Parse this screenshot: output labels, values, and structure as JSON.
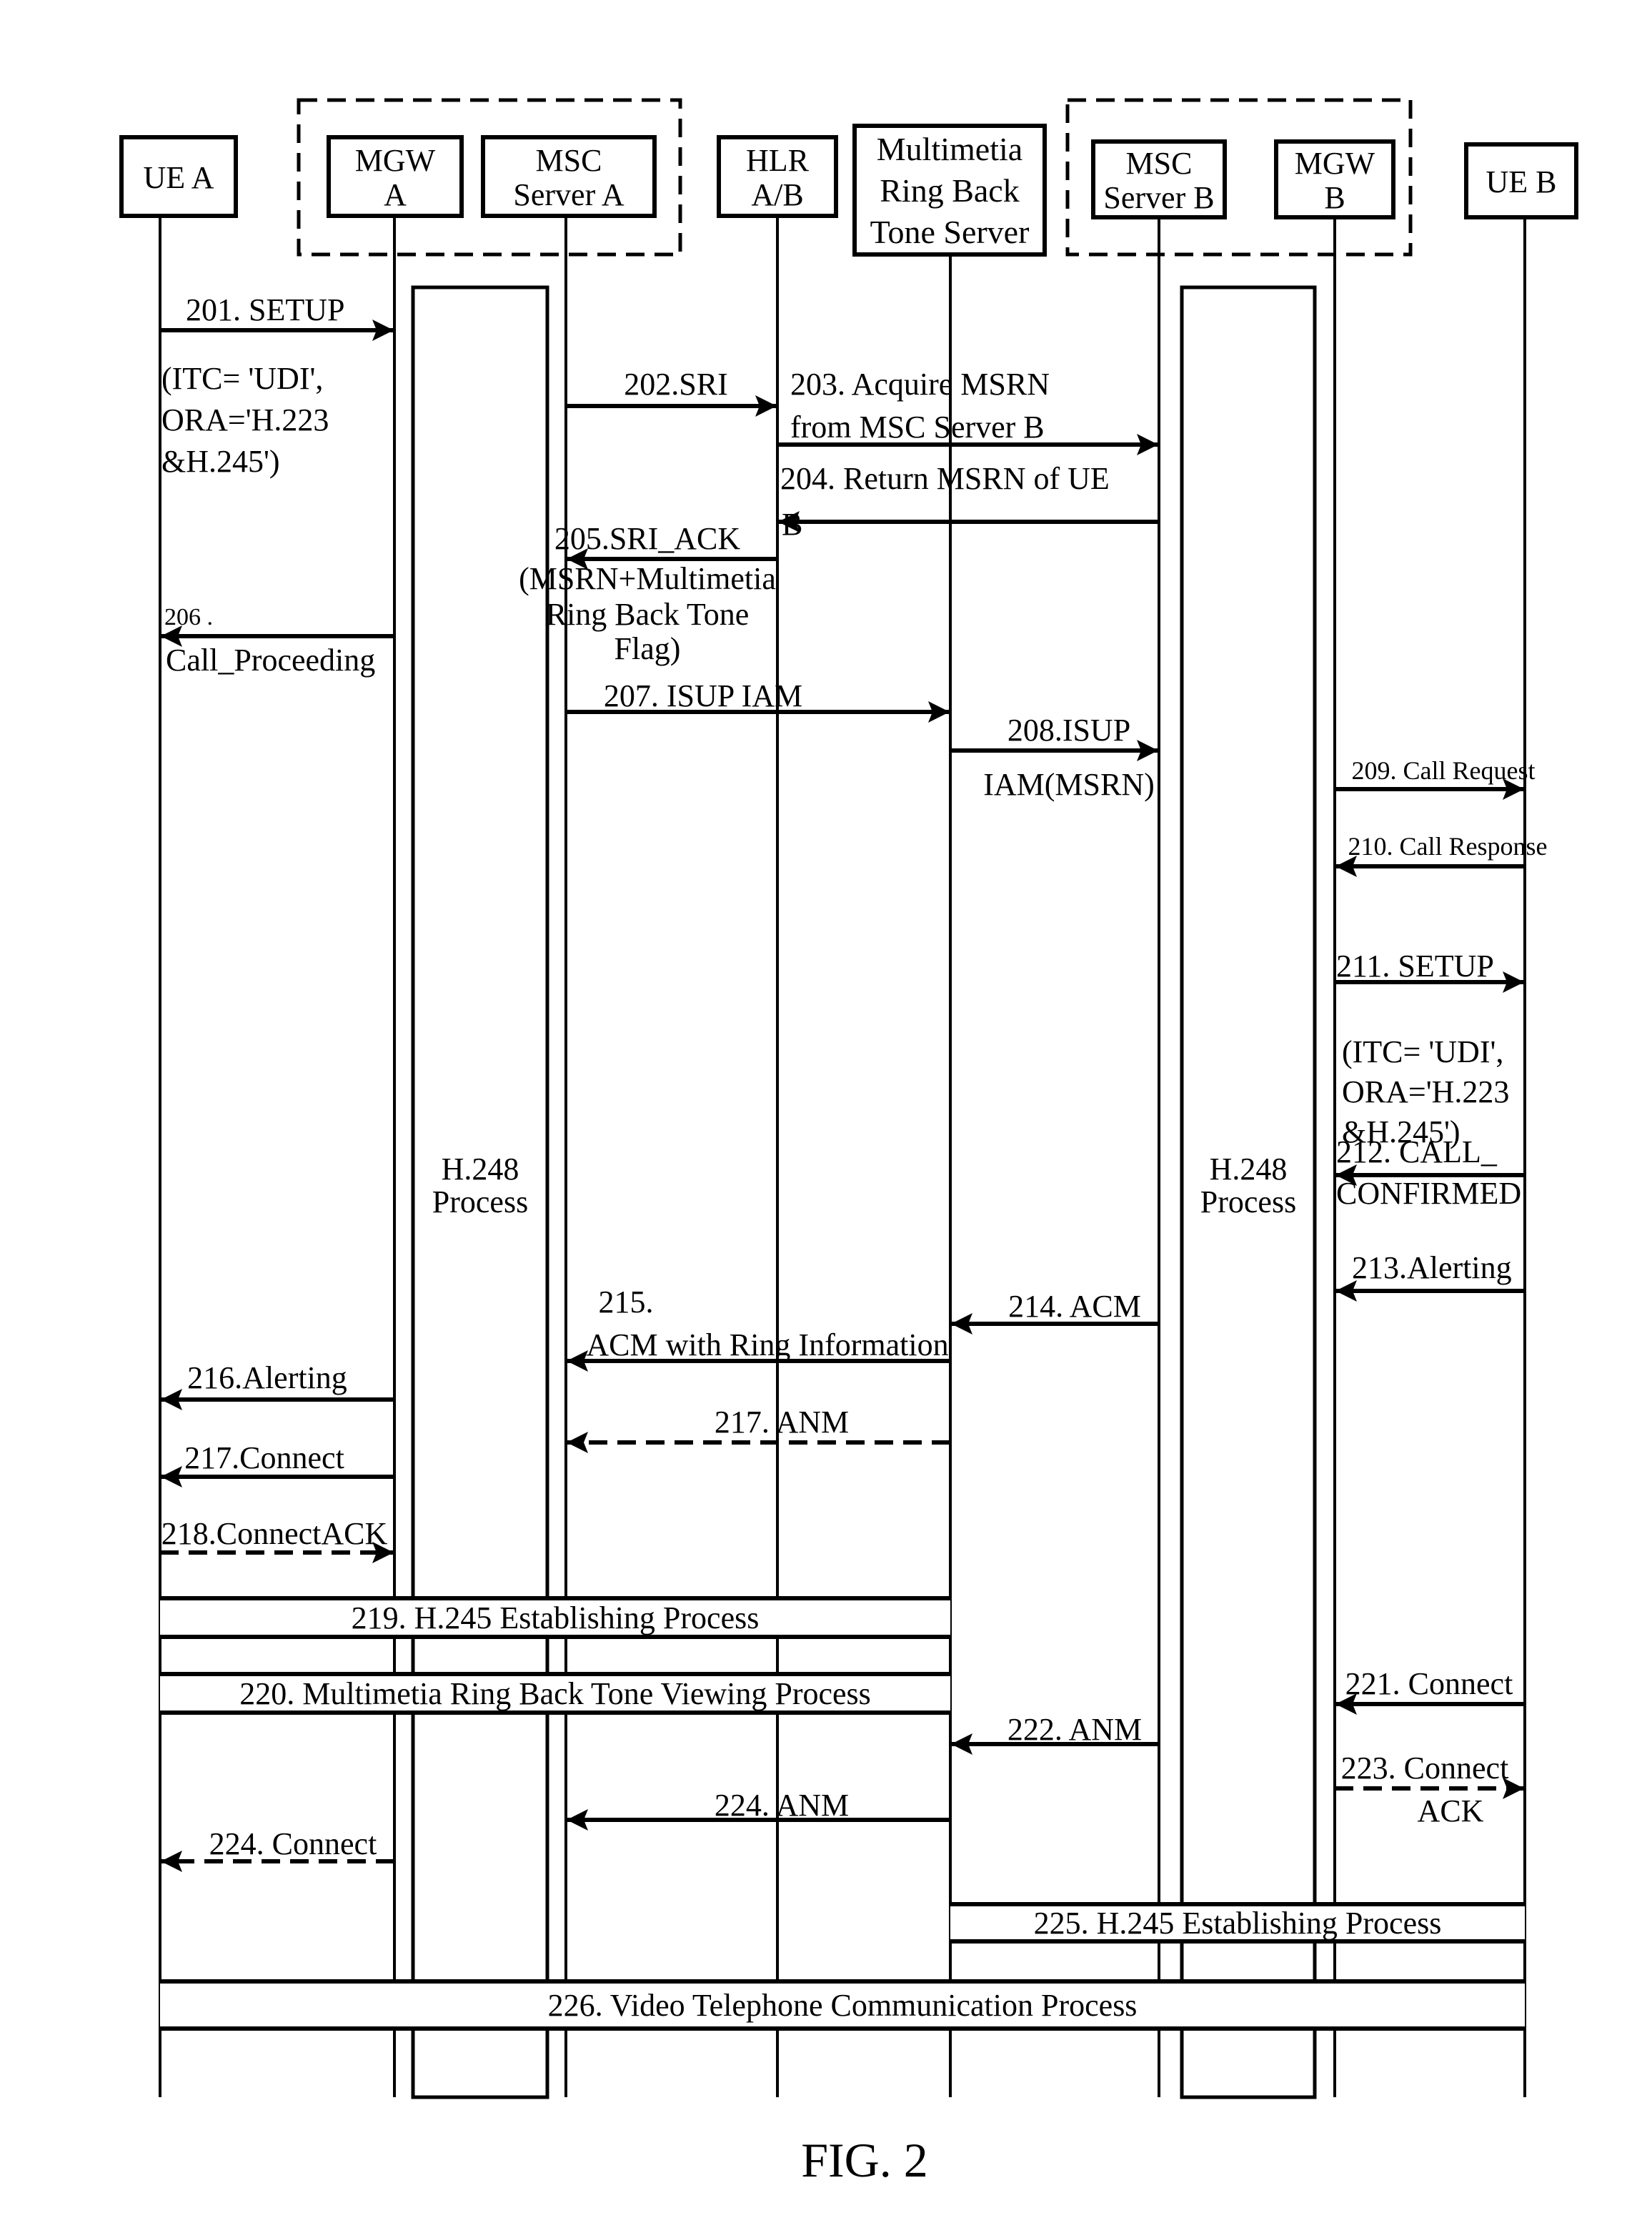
{
  "figure": {
    "caption": "FIG. 2",
    "groups": [
      {
        "id": "network-a",
        "label": "",
        "members": [
          "mgw-a",
          "msc-a"
        ]
      },
      {
        "id": "network-b",
        "label": "",
        "members": [
          "msc-b",
          "mgw-b"
        ]
      }
    ],
    "entities": [
      {
        "id": "ue-a",
        "lines": [
          "UE A"
        ]
      },
      {
        "id": "mgw-a",
        "lines": [
          "MGW",
          "A"
        ]
      },
      {
        "id": "msc-a",
        "lines": [
          "MSC",
          "Server A"
        ]
      },
      {
        "id": "hlr",
        "lines": [
          "HLR",
          "A/B"
        ]
      },
      {
        "id": "mrbt",
        "lines": [
          "Multimetia",
          "Ring Back",
          "Tone Server"
        ]
      },
      {
        "id": "msc-b",
        "lines": [
          "MSC",
          "Server B"
        ]
      },
      {
        "id": "mgw-b",
        "lines": [
          "MGW",
          "B"
        ]
      },
      {
        "id": "ue-b",
        "lines": [
          "UE B"
        ]
      }
    ],
    "processes": [
      {
        "id": "h248-a",
        "lines": [
          "H.248",
          "Process"
        ],
        "between": [
          "mgw-a",
          "msc-a"
        ]
      },
      {
        "id": "h248-b",
        "lines": [
          "H.248",
          "Process"
        ],
        "between": [
          "msc-b",
          "mgw-b"
        ]
      }
    ],
    "messages": [
      {
        "id": "201",
        "from": "ue-a",
        "to": "mgw-a",
        "style": "solid",
        "lines": [
          "201. SETUP",
          "(ITC= 'UDI',",
          "ORA='H.223",
          "&H.245')"
        ]
      },
      {
        "id": "202",
        "from": "msc-a",
        "to": "hlr",
        "style": "solid",
        "lines": [
          "202.SRI"
        ]
      },
      {
        "id": "203",
        "from": "hlr",
        "to": "msc-b",
        "style": "solid",
        "lines": [
          "203. Acquire MSRN",
          "from MSC Server B"
        ]
      },
      {
        "id": "204",
        "from": "msc-b",
        "to": "hlr",
        "style": "solid",
        "lines": [
          "204. Return MSRN of UE",
          "B"
        ]
      },
      {
        "id": "205",
        "from": "hlr",
        "to": "msc-a",
        "style": "solid",
        "lines": [
          "205.SRI_ACK",
          "(MSRN+Multimetia",
          "Ring Back Tone",
          "Flag)"
        ]
      },
      {
        "id": "206",
        "from": "mgw-a",
        "to": "ue-a",
        "style": "solid",
        "lines": [
          "206 .",
          "Call_Proceeding"
        ]
      },
      {
        "id": "207",
        "from": "msc-a",
        "to": "mrbt",
        "style": "solid",
        "lines": [
          "207. ISUP IAM"
        ]
      },
      {
        "id": "208",
        "from": "mrbt",
        "to": "msc-b",
        "style": "solid",
        "lines": [
          "208.ISUP",
          "IAM(MSRN)"
        ]
      },
      {
        "id": "209",
        "from": "mgw-b",
        "to": "ue-b",
        "style": "solid",
        "lines": [
          "209. Call Request"
        ]
      },
      {
        "id": "210",
        "from": "ue-b",
        "to": "mgw-b",
        "style": "solid",
        "lines": [
          "210. Call Response"
        ]
      },
      {
        "id": "211",
        "from": "mgw-b",
        "to": "ue-b",
        "style": "solid",
        "lines": [
          "211. SETUP",
          "(ITC= 'UDI',",
          "ORA='H.223",
          "&H.245')"
        ]
      },
      {
        "id": "212",
        "from": "ue-b",
        "to": "mgw-b",
        "style": "solid",
        "lines": [
          "212. CALL_",
          "CONFIRMED"
        ]
      },
      {
        "id": "213",
        "from": "ue-b",
        "to": "mgw-b",
        "style": "solid",
        "lines": [
          "213.Alerting"
        ]
      },
      {
        "id": "214",
        "from": "msc-b",
        "to": "mrbt",
        "style": "solid",
        "lines": [
          "214. ACM"
        ]
      },
      {
        "id": "215",
        "from": "mrbt",
        "to": "msc-a",
        "style": "solid",
        "lines": [
          "215.",
          "ACM with Ring Information"
        ]
      },
      {
        "id": "216",
        "from": "mgw-a",
        "to": "ue-a",
        "style": "solid",
        "lines": [
          "216.Alerting"
        ]
      },
      {
        "id": "217a",
        "from": "mrbt",
        "to": "msc-a",
        "style": "dashed",
        "lines": [
          "217. ANM"
        ]
      },
      {
        "id": "217b",
        "from": "mgw-a",
        "to": "ue-a",
        "style": "solid",
        "lines": [
          "217.Connect"
        ]
      },
      {
        "id": "218",
        "from": "ue-a",
        "to": "mgw-a",
        "style": "dashed",
        "lines": [
          "218.ConnectACK"
        ]
      },
      {
        "id": "221",
        "from": "ue-b",
        "to": "mgw-b",
        "style": "solid",
        "lines": [
          "221. Connect"
        ]
      },
      {
        "id": "222",
        "from": "msc-b",
        "to": "mrbt",
        "style": "solid",
        "lines": [
          "222. ANM"
        ]
      },
      {
        "id": "223",
        "from": "mgw-b",
        "to": "ue-b",
        "style": "dashed",
        "lines": [
          "223. Connect",
          "ACK"
        ]
      },
      {
        "id": "224a",
        "from": "mrbt",
        "to": "msc-a",
        "style": "solid",
        "lines": [
          "224. ANM"
        ]
      },
      {
        "id": "224b",
        "from": "mgw-a",
        "to": "ue-a",
        "style": "dashed",
        "lines": [
          "224. Connect"
        ]
      }
    ],
    "spans": [
      {
        "id": "219",
        "from": "ue-a",
        "to": "mrbt",
        "label": "219. H.245 Establishing Process"
      },
      {
        "id": "220",
        "from": "ue-a",
        "to": "mrbt",
        "label": "220. Multimetia Ring Back Tone Viewing Process"
      },
      {
        "id": "225",
        "from": "mrbt",
        "to": "ue-b",
        "label": "225. H.245 Establishing Process"
      },
      {
        "id": "226",
        "from": "ue-a",
        "to": "ue-b",
        "label": "226. Video Telephone Communication Process"
      }
    ]
  }
}
